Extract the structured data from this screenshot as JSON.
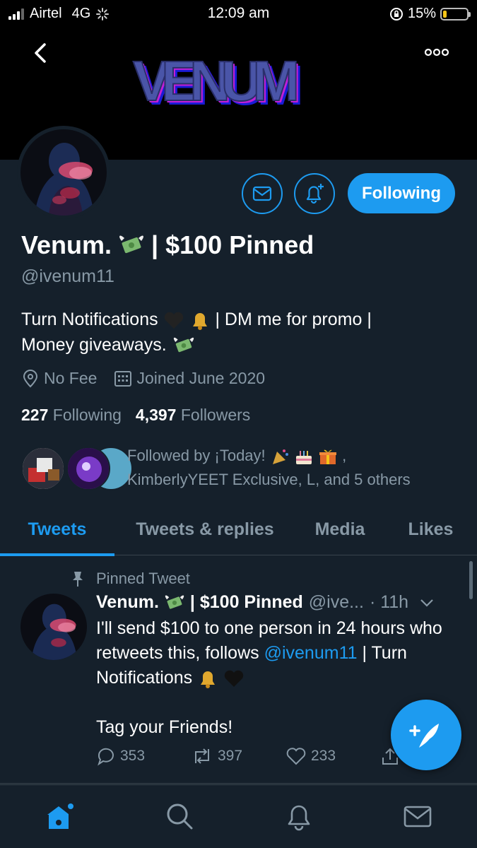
{
  "status_bar": {
    "carrier": "Airtel",
    "network": "4G",
    "time": "12:09 am",
    "battery": "15%"
  },
  "colors": {
    "background": "#15202b",
    "accent": "#1d9bf0",
    "secondary_text": "#8899a6",
    "divider": "#38444d"
  },
  "header": {
    "banner_logo_text": "VENUM"
  },
  "profile": {
    "name_part1": "Venum.",
    "name_part2": "| $100 Pinned",
    "handle": "@ivenum11",
    "bio_line1_a": "Turn Notifications",
    "bio_line1_b": "| DM me for promo |",
    "bio_line2": "Money giveaways.",
    "location": "No Fee",
    "joined": "Joined June 2020",
    "following_count": "227",
    "following_label": "Following",
    "followers_count": "4,397",
    "followers_label": "Followers",
    "follow_button": "Following",
    "followed_by_a": "Followed by ¡Today!",
    "followed_by_b": ",",
    "followed_by_c": "KimberlyYEET Exclusive, L, and 5 others"
  },
  "tabs": [
    {
      "label": "Tweets",
      "active": true
    },
    {
      "label": "Tweets & replies",
      "active": false
    },
    {
      "label": "Media",
      "active": false
    },
    {
      "label": "Likes",
      "active": false
    }
  ],
  "tweet": {
    "pinned_label": "Pinned Tweet",
    "name_part1": "Venum.",
    "name_part2": "| $100 Pinned",
    "handle": "@ive...",
    "time": "· 11h",
    "text_1": "I'll send $100 to one person in 24 hours who retweets this, follows ",
    "mention": "@ivenum11",
    "text_2": " | Turn Notifications ",
    "text_3": "Tag your Friends!",
    "replies": "353",
    "retweets": "397",
    "likes": "233"
  },
  "icons": {
    "back": "chevron-left-icon",
    "more": "more-dots-icon",
    "message": "envelope-icon",
    "notify": "bell-plus-icon",
    "location": "location-pin-icon",
    "calendar": "calendar-icon",
    "pin": "pin-icon",
    "compose": "compose-feather-icon",
    "nav": [
      "home-icon",
      "search-icon",
      "notifications-icon",
      "messages-icon"
    ]
  }
}
